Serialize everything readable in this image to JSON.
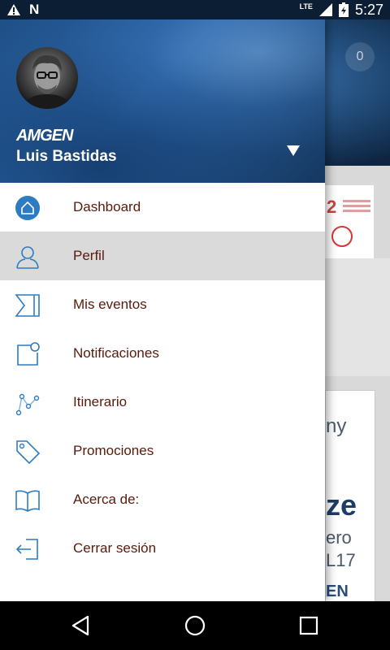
{
  "status_bar": {
    "time": "5:27",
    "network": "LTE"
  },
  "background_app": {
    "badge_count": "0",
    "card_text_1": "ny",
    "card_text_2": "ze",
    "card_text_3": "ero",
    "card_text_4": "L17",
    "card_text_5": "EN"
  },
  "drawer": {
    "brand": "AMGEN",
    "user_name": "Luis Bastidas",
    "menu": [
      {
        "label": "Dashboard",
        "icon": "home-icon"
      },
      {
        "label": "Perfil",
        "icon": "user-icon",
        "active": true
      },
      {
        "label": "Mis eventos",
        "icon": "events-icon"
      },
      {
        "label": "Notificaciones",
        "icon": "notification-icon"
      },
      {
        "label": "Itinerario",
        "icon": "itinerary-icon"
      },
      {
        "label": "Promociones",
        "icon": "tag-icon"
      },
      {
        "label": "Acerca de:",
        "icon": "book-icon"
      },
      {
        "label": "Cerrar sesión",
        "icon": "logout-icon"
      }
    ]
  },
  "colors": {
    "accent": "#2d7cc1",
    "menu_text": "#5a1a0a",
    "active_row": "#dadada"
  }
}
